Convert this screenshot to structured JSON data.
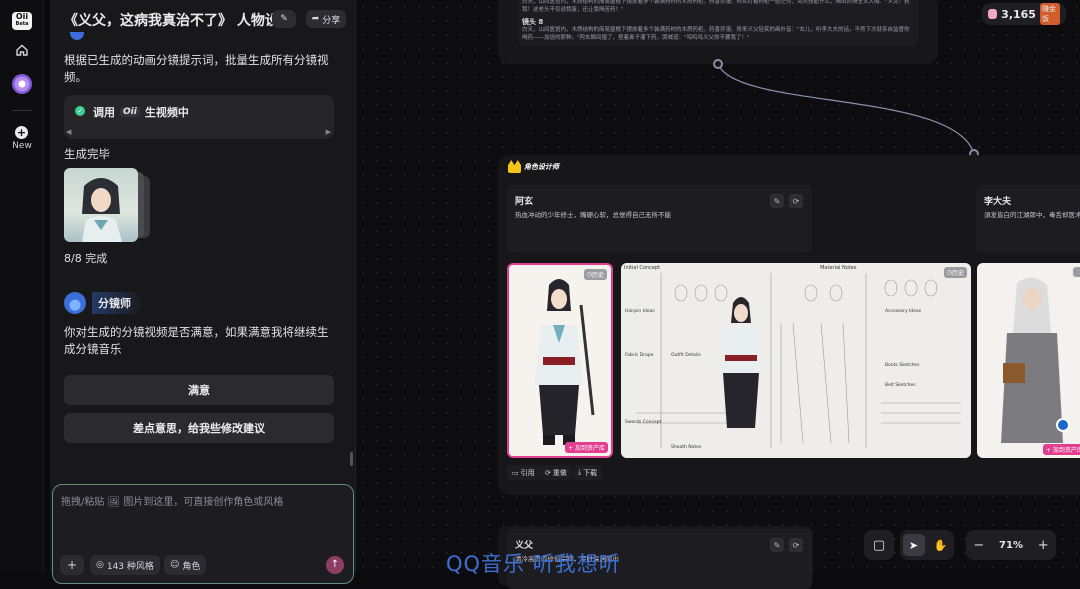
{
  "rail": {
    "logo_text": "Oii",
    "logo_sub": "Beta",
    "new_label": "New"
  },
  "chat": {
    "title": "《义父，这病我真治不了》 人物设...",
    "share_label": "分享",
    "intro_text": "根据已生成的动画分镜提示词，批量生成所有分镜视频。",
    "status_prefix": "调用",
    "status_model": "Oii",
    "status_suffix": "生视频中",
    "done_label": "生成完毕",
    "progress": "8/8 完成",
    "agent_name": "分镜师",
    "agent_question": "你对生成的分镜视频是否满意，如果满意我将继续生成分镜音乐",
    "btn_satisfied": "满意",
    "btn_suggest": "差点意思，给我些修改建议",
    "input_placeholder": "拖拽/粘贴 🖼 图片到这里，可直接创作角色或风格",
    "style_count": "143 种风格",
    "role_chip": "角色"
  },
  "canvas": {
    "credits": "3,165",
    "credits_badge": "赚金饭",
    "storyboard_top": "白天，山间医馆内，木质结构的简易屋檐下摆放着多个装满药材的木质药柜。药香弥漫。阿玄盯着药柜一脸茫然，突然想起什么，陶出抑扬全五大喊：\"义父！救我！这老头不仅说我废，还让我喝苦药！\"",
    "shot_label": "镜头 8",
    "storyboard_shot8": "白天，山间医馆内，木质结构的简易屋檐下摆放着多个装满药材的木质药柜。药香弥漫。佟来义父轻笑的画外音：\"玄儿，听李大夫的话，不然下次就亲自监督你喝药——加倍的那种。\"阿玄瞬间僵了，捏着鼻子灌下药，哭喊道：\"呜呜呜义父你不要我了！\"",
    "designer_label": "角色设计师",
    "char1_name": "阿玄",
    "char1_desc": "热血冲动的少年修士，嘴硬心软，总觉得自己无所不能",
    "char2_name": "李大夫",
    "char2_desc": "須发皆白的江湖郎中，毒舌却医术",
    "char3_name": "义父",
    "char3_desc": "清冷高贵的修仙宗师，平时深居简出",
    "history_label": "历史",
    "add_to_assets": "+ 加到资产库",
    "action_quote": "引用",
    "action_redo": "重做",
    "action_download": "下载",
    "zoom": "71%",
    "sheet_labels": [
      "Initial Concept",
      "Material Notes",
      "Hairpin Ideas",
      "Accessory Ideas",
      "Fabric Drape",
      "Outfit Details",
      "Swords Concept",
      "Sheath Notes",
      "Boots Sketches",
      "Belt Sketches"
    ]
  },
  "watermark": "QQ音乐 听我想听",
  "colors": {
    "accent_pink": "#e23d8f",
    "accent_green": "#3ccf8e",
    "watermark_blue": "#3b6fd1",
    "agent_blue": "#4a7ef0"
  }
}
